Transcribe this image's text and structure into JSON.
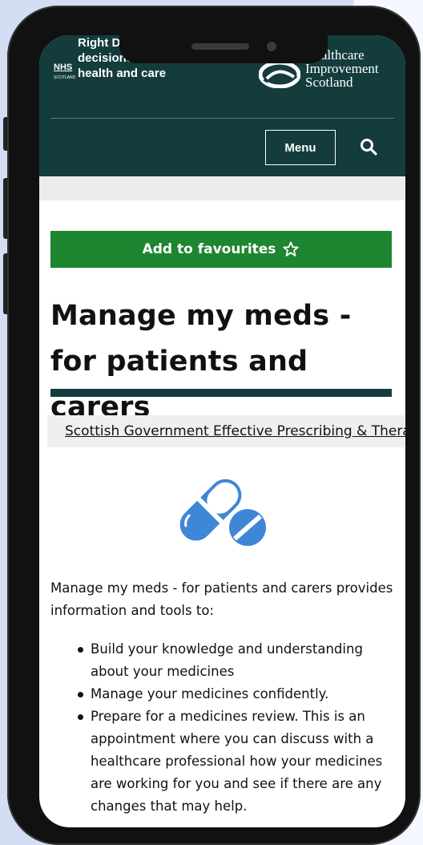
{
  "header": {
    "nhs_logo_text": "NHS",
    "nhs_logo_sub": "SCOTLAND",
    "tagline": "Right Decisions supporting decisions for Scotland's health and care",
    "his_logo_lines": [
      "Healthcare",
      "Improvement",
      "Scotland"
    ],
    "menu_label": "Menu",
    "search_icon": "search-icon"
  },
  "page": {
    "favourite_button_label": "Add to favourites",
    "favourite_icon": "star-outline-icon",
    "title": "Manage my meds - for patients and carers",
    "tag_icon": "building-icon",
    "tag_label": "Scottish Government Effective Prescribing & Therapeutics",
    "hero_icon": "pills-icon",
    "accent_color": "#3f86d6",
    "intro": "Manage my meds - for patients and carers provides information and tools to:",
    "bullets": [
      "Build your knowledge and understanding about your medicines",
      "Manage your medicines confidently.",
      "Prepare for a medicines review. This is an appointment where you can discuss with a healthcare professional how your medicines are working for you and see if there are any changes that may help."
    ]
  },
  "colors": {
    "header_bg": "#143c3d",
    "favourite_bg": "#1e8531",
    "backdrop": "#d3def4"
  }
}
